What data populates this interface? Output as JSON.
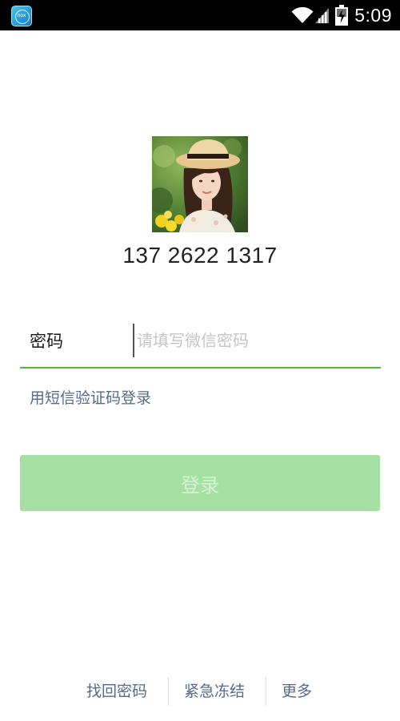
{
  "status_bar": {
    "time": "5:09",
    "app_icon": "nox-app-icon",
    "app_icon_text": "nox",
    "icons": [
      "wifi-icon",
      "signal-icon",
      "battery-charging-icon"
    ]
  },
  "account": {
    "avatar": "profile-photo",
    "phone": "137 2622 1317"
  },
  "password": {
    "label": "密码",
    "placeholder": "请填写微信密码",
    "value": ""
  },
  "sms_login_label": "用短信验证码登录",
  "login_button_label": "登录",
  "footer": {
    "links": [
      "找回密码",
      "紧急冻结",
      "更多"
    ]
  },
  "colors": {
    "accent_green": "#54b839",
    "button_disabled_bg": "#a3e0a2",
    "link_blue": "#56698f"
  }
}
